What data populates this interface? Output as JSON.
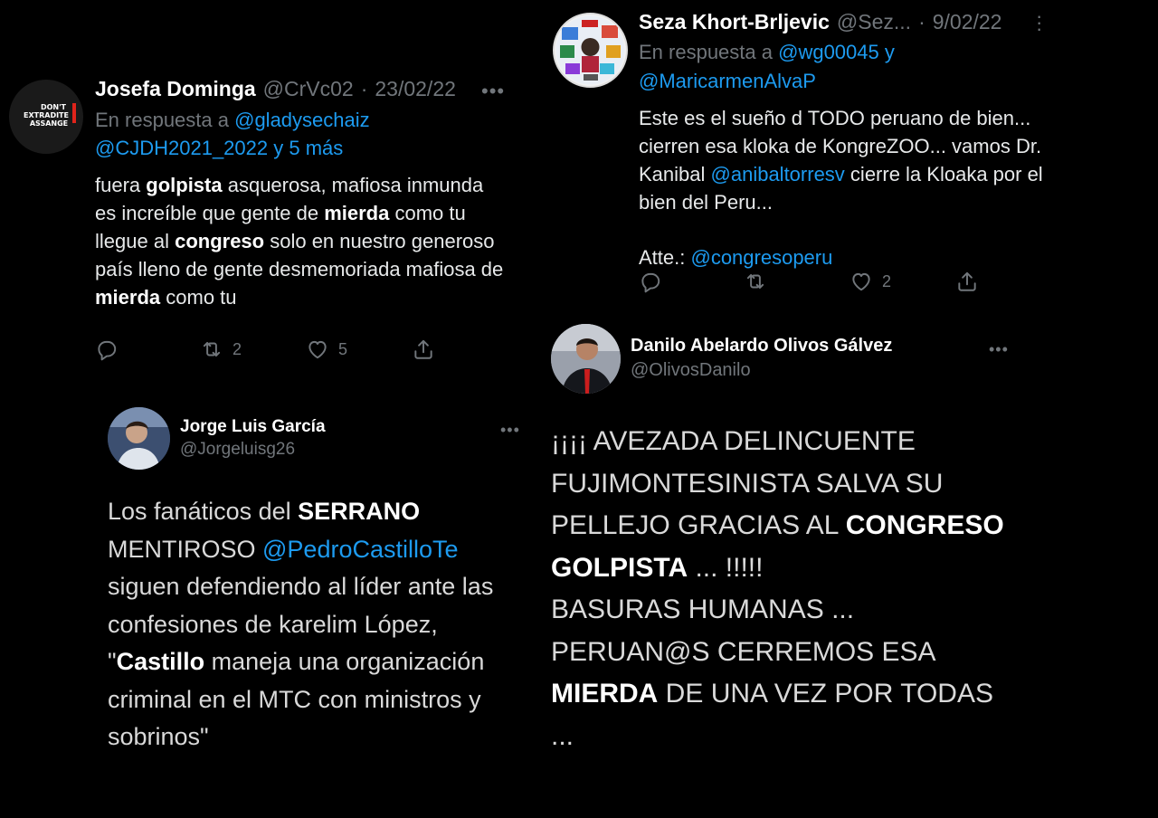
{
  "tweet1": {
    "name": "Josefa Dominga",
    "handle": "@CrVc02",
    "sep": "·",
    "date": "23/02/22",
    "avatar_text": [
      "DON'T",
      "EXTRADITE",
      "ASSANGE"
    ],
    "reply_prefix": "En respuesta a",
    "reply_user1": "@gladysechaiz",
    "reply_user2": "@CJDH2021_2022",
    "reply_more": "y 5 más",
    "body": [
      {
        "t": "fuera ",
        "b": false
      },
      {
        "t": "golpista",
        "b": true
      },
      {
        "t": " asquerosa, mafiosa inmunda es increíble que gente de ",
        "b": false
      },
      {
        "t": "mierda",
        "b": true
      },
      {
        "t": " como tu llegue al ",
        "b": false
      },
      {
        "t": "congreso",
        "b": true
      },
      {
        "t": " solo en nuestro generoso país lleno de gente desmemoriada mafiosa de ",
        "b": false
      },
      {
        "t": "mierda",
        "b": true
      },
      {
        "t": " como tu",
        "b": false
      }
    ],
    "retweets": "2",
    "likes": "5"
  },
  "tweet2": {
    "name": "Seza Khort-Brljevic",
    "handle": "@Sez...",
    "sep": "·",
    "date": "9/02/22",
    "reply_prefix": "En respuesta a",
    "reply_user1": "@wg00045",
    "reply_and": "y",
    "reply_user2": "@MaricarmenAlvaP",
    "body_line1": "Este es el sueño d TODO peruano de bien... cierren esa kloka de KongreZOO... vamos Dr. Kanibal ",
    "body_mention": "@anibaltorresv",
    "body_line2": " cierre la Kloaka por el bien del Peru...",
    "sign_prefix": "Atte.: ",
    "sign_mention": "@congresoperu",
    "likes": "2"
  },
  "tweet3": {
    "name": "Jorge Luis García",
    "handle": "@Jorgeluisg26",
    "body": [
      {
        "t": "Los fanáticos del ",
        "b": false
      },
      {
        "t": "SERRANO",
        "b": true
      },
      {
        "t": " MENTIROSO ",
        "b": false
      },
      {
        "t": "@PedroCastilloTe",
        "link": true
      },
      {
        "t": " siguen defendiendo al líder ante las confesiones de karelim López, \"",
        "b": false
      },
      {
        "t": "Castillo",
        "b": true
      },
      {
        "t": " maneja una organización criminal en el MTC con ministros y sobrinos\"",
        "b": false
      }
    ]
  },
  "tweet4": {
    "name": "Danilo Abelardo Olivos Gálvez",
    "handle": "@OlivosDanilo",
    "body": [
      {
        "t": "¡¡¡¡ AVEZADA DELINCUENTE FUJIMONTESINISTA SALVA SU PELLEJO GRACIAS AL ",
        "b": false
      },
      {
        "t": "CONGRESO GOLPISTA",
        "b": true
      },
      {
        "t": " ... !!!!!",
        "b": false
      },
      {
        "br": true
      },
      {
        "t": "BASURAS HUMANAS ...",
        "b": false
      },
      {
        "br": true
      },
      {
        "t": "PERUAN@S CERREMOS ESA ",
        "b": false
      },
      {
        "t": "MIERDA",
        "b": true
      },
      {
        "t": " DE UNA VEZ POR TODAS ...",
        "b": false
      }
    ]
  },
  "icons": {
    "more": "more-dots-icon",
    "reply": "reply-icon",
    "retweet": "retweet-icon",
    "like": "heart-icon",
    "share": "share-icon"
  },
  "colors": {
    "background": "#000000",
    "link": "#1d9bf0",
    "muted": "#71767b",
    "text": "#e7e9ea"
  }
}
